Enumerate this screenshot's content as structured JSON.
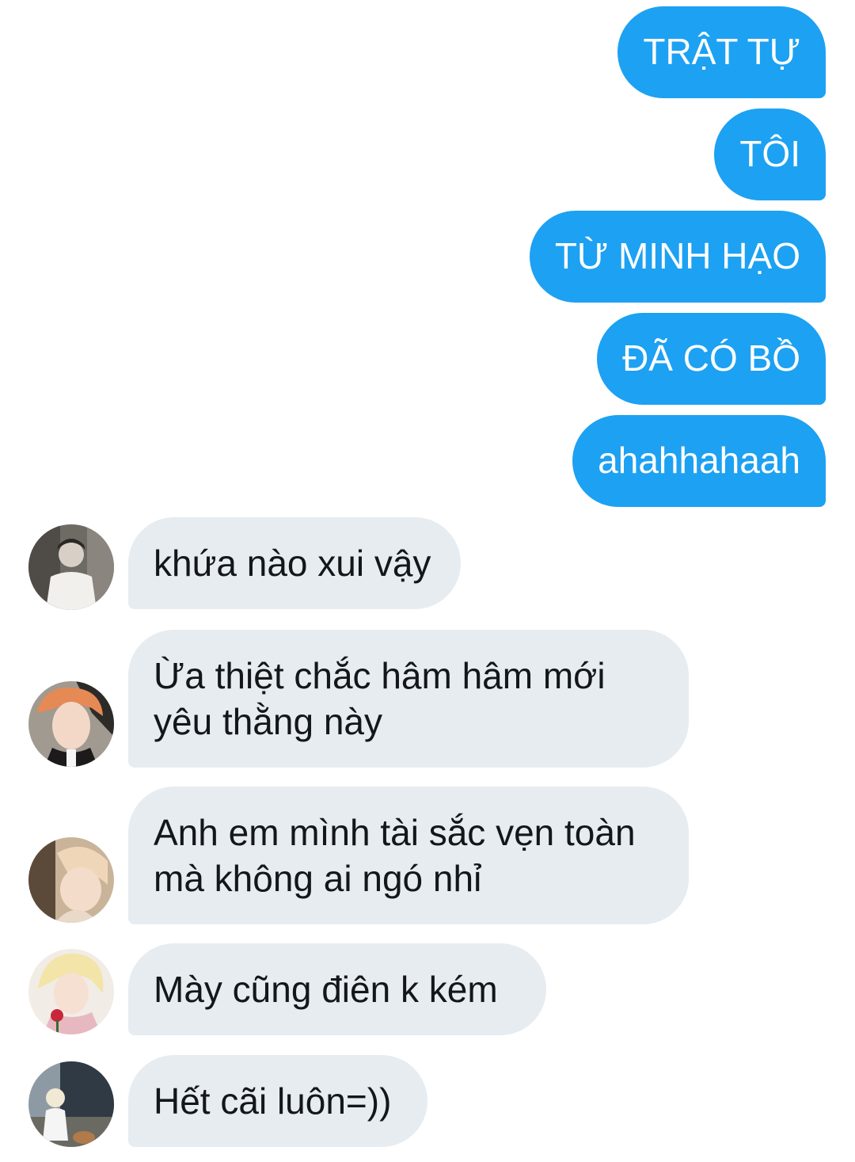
{
  "conversation": {
    "outgoing": [
      {
        "text": "TRẬT TỰ"
      },
      {
        "text": "TÔI"
      },
      {
        "text": "TỪ MINH HẠO"
      },
      {
        "text": "ĐÃ CÓ BỒ"
      },
      {
        "text": "ahahhahaah"
      }
    ],
    "incoming": [
      {
        "lines": [
          "khứa nào xui vậy"
        ]
      },
      {
        "lines": [
          "Ừa thiệt chắc hâm hâm mới",
          "yêu thằng này"
        ]
      },
      {
        "lines": [
          "Anh em mình tài sắc vẹn toàn",
          "mà không ai ngó nhỉ"
        ]
      },
      {
        "lines": [
          "Mày cũng điên k kém"
        ]
      },
      {
        "lines": [
          "Hết cãi luôn=))"
        ]
      }
    ]
  },
  "colors": {
    "outgoing_bubble": "#1da1f2",
    "incoming_bubble": "#e6ecf0",
    "incoming_text": "#14171a",
    "background": "#ffffff"
  }
}
